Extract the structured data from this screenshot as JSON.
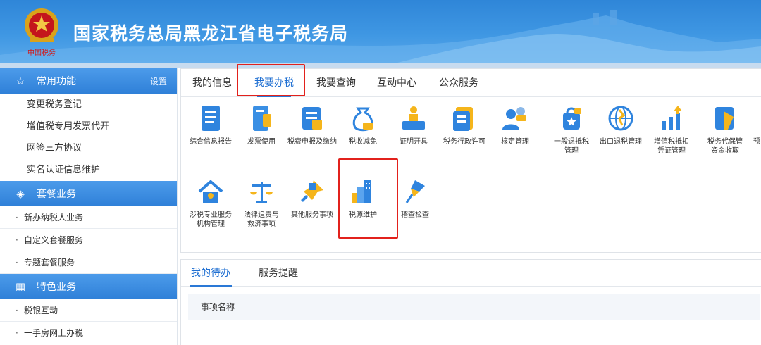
{
  "header": {
    "title": "国家税务总局黑龙江省电子税务局",
    "emblem_text": "中国税务"
  },
  "sidebar": {
    "common": {
      "title": "常用功能",
      "icon": "star-icon",
      "settings_label": "设置",
      "items": [
        "变更税务登记",
        "增值税专用发票代开",
        "网签三方协议",
        "实名认证信息维护"
      ]
    },
    "package": {
      "title": "套餐业务",
      "icon": "layers-icon",
      "items": [
        "新办纳税人业务",
        "自定义套餐服务",
        "专题套餐服务"
      ]
    },
    "special": {
      "title": "特色业务",
      "icon": "grid-icon",
      "items": [
        "税银互动",
        "一手房网上办税"
      ]
    }
  },
  "main": {
    "tabs": [
      {
        "label": "我的信息"
      },
      {
        "label": "我要办税"
      },
      {
        "label": "我要查询"
      },
      {
        "label": "互动中心"
      },
      {
        "label": "公众服务"
      }
    ],
    "active_tab": "我要办税",
    "services": [
      {
        "label": "综合信息报告",
        "icon": "report-icon"
      },
      {
        "label": "发票使用",
        "icon": "invoice-icon"
      },
      {
        "label": "税费申报及缴纳",
        "icon": "declare-icon"
      },
      {
        "label": "税收减免",
        "icon": "money-bag-icon"
      },
      {
        "label": "证明开具",
        "icon": "certificate-icon"
      },
      {
        "label": "税务行政许可",
        "icon": "permit-icon"
      },
      {
        "label": "核定管理",
        "icon": "users-icon"
      },
      {
        "label": "一般退抵税管理",
        "icon": "refund-bag-icon"
      },
      {
        "label": "出口退税管理",
        "icon": "globe-icon"
      },
      {
        "label": "增值税抵扣凭证管理",
        "icon": "chart-up-icon"
      },
      {
        "label": "税务代保管资金收取",
        "icon": "vault-icon"
      },
      {
        "label": "预",
        "icon": "partial-icon"
      },
      {
        "label": "涉税专业服务机构管理",
        "icon": "house-tools-icon"
      },
      {
        "label": "法律追责与救济事项",
        "icon": "scales-icon"
      },
      {
        "label": "其他服务事项",
        "icon": "pin-icon"
      },
      {
        "label": "税源维护",
        "icon": "buildings-icon"
      },
      {
        "label": "稽查检查",
        "icon": "pushpin-icon"
      }
    ],
    "services_labels_display": {
      "l7": [
        "一般退抵税",
        "管理"
      ],
      "l9": [
        "增值税抵扣",
        "凭证管理"
      ],
      "l10": [
        "税务代保管",
        "资金收取"
      ],
      "l12": [
        "涉税专业服务",
        "机构管理"
      ],
      "l13": [
        "法律追责与",
        "救济事项"
      ]
    }
  },
  "todo": {
    "tabs": [
      {
        "label": "我的待办"
      },
      {
        "label": "服务提醒"
      }
    ],
    "column_header": "事项名称"
  },
  "colors": {
    "header_blue": "#3a90e0",
    "sidebar_head": "#2f80d8",
    "active_blue": "#1f6fd2",
    "highlight_red": "#e2211c"
  }
}
